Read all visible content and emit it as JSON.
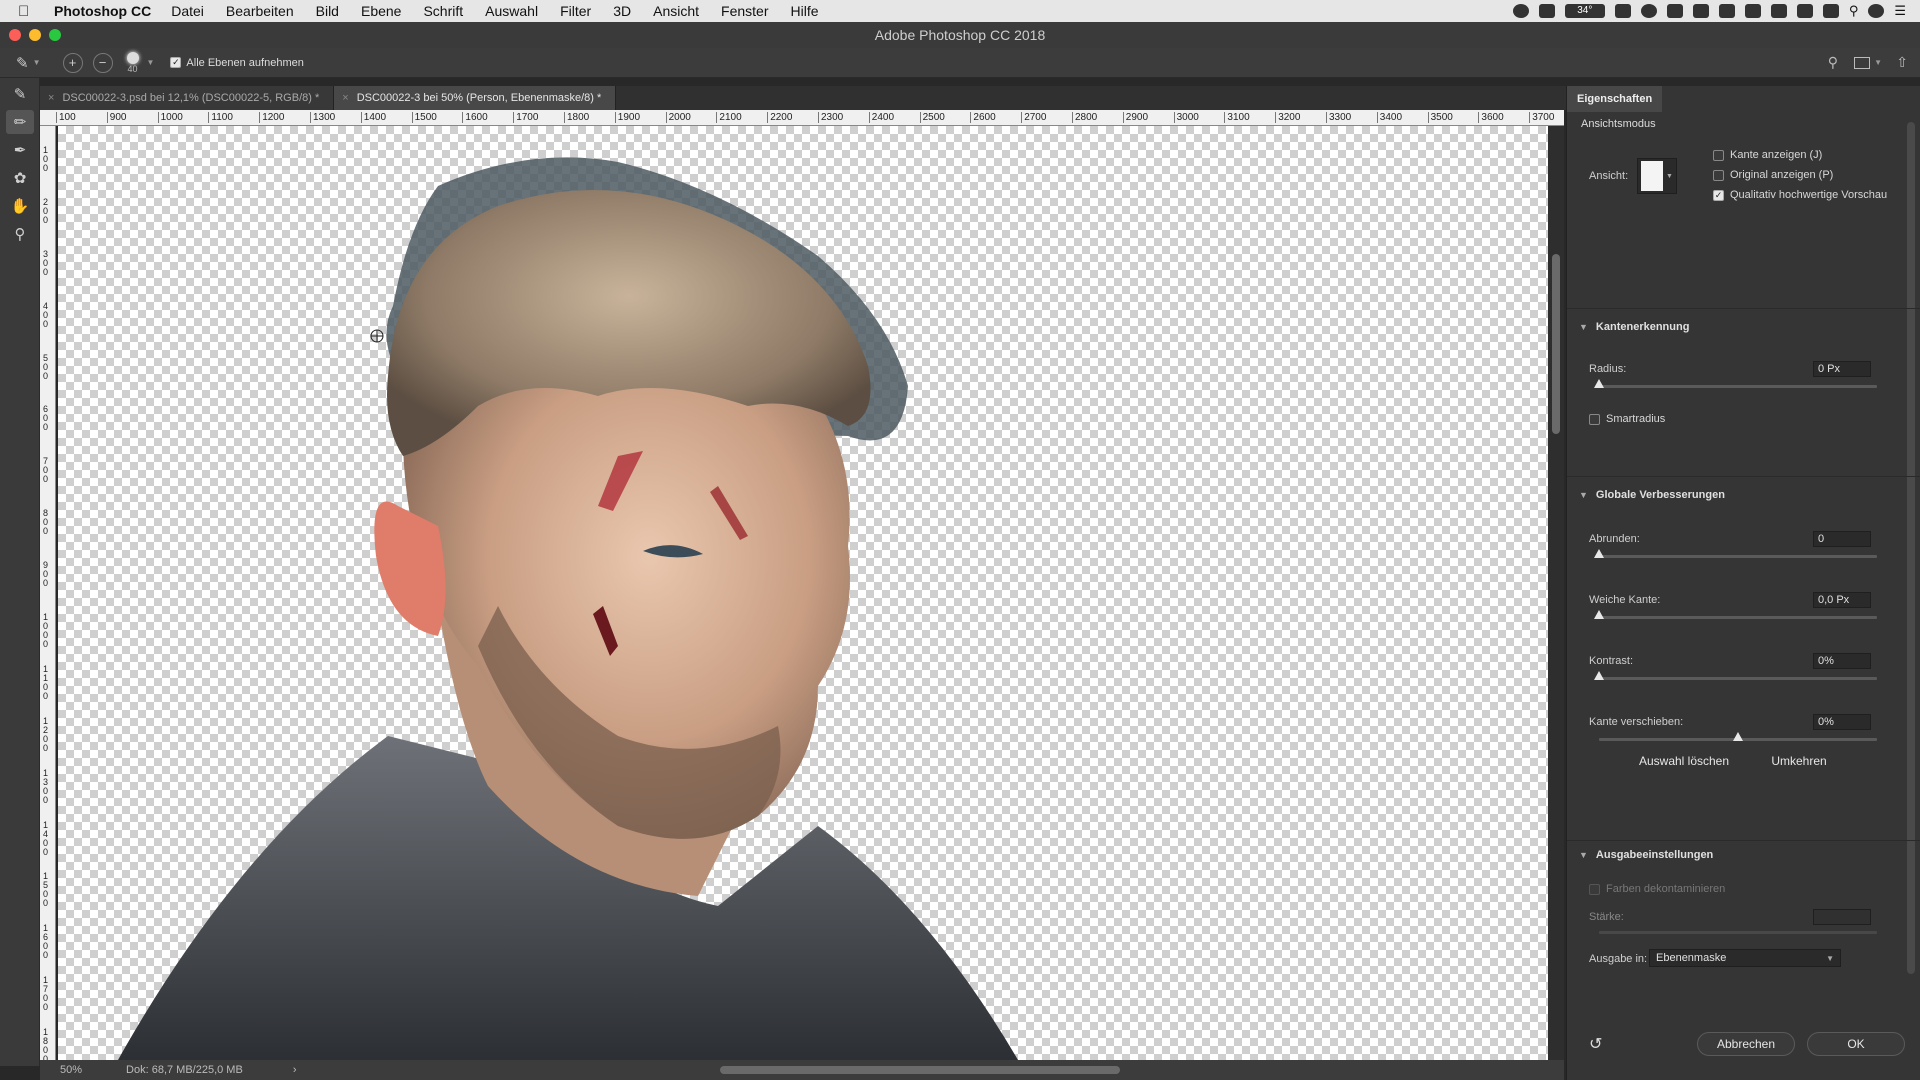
{
  "menubar": {
    "app_name": "Photoshop CC",
    "items": [
      "Datei",
      "Bearbeiten",
      "Bild",
      "Ebene",
      "Schrift",
      "Auswahl",
      "Filter",
      "3D",
      "Ansicht",
      "Fenster",
      "Hilfe"
    ],
    "temperature": "34°"
  },
  "window": {
    "title": "Adobe Photoshop CC 2018"
  },
  "options": {
    "brush_size": "40",
    "sample_all_layers_label": "Alle Ebenen aufnehmen",
    "sample_all_layers_checked": true
  },
  "tabs": [
    {
      "label": "DSC00022-3.psd bei 12,1% (DSC00022-5, RGB/8) *",
      "active": false
    },
    {
      "label": "DSC00022-3 bei 50% (Person, Ebenenmaske/8) *",
      "active": true
    }
  ],
  "ruler": {
    "top_ticks": [
      "100",
      "900",
      "1000",
      "1100",
      "1200",
      "1300",
      "1400",
      "1500",
      "1600",
      "1700",
      "1800",
      "1900",
      "2000",
      "2100",
      "2200",
      "2300",
      "2400",
      "2500",
      "2600",
      "2700",
      "2800",
      "2900",
      "3000",
      "3100",
      "3200",
      "3300",
      "3400",
      "3500",
      "3600",
      "3700"
    ],
    "left_ticks": [
      "1 0 0",
      "2 0 0",
      "3 0 0",
      "4 0 0",
      "5 0 0",
      "6 0 0",
      "7 0 0",
      "8 0 0",
      "9 0 0",
      "1 0 0 0",
      "1 1 0 0",
      "1 2 0 0",
      "1 3 0 0",
      "1 4 0 0",
      "1 5 0 0",
      "1 6 0 0",
      "1 7 0 0",
      "1 8 0 0"
    ]
  },
  "status": {
    "zoom": "50%",
    "doc": "Dok: 68,7 MB/225,0 MB",
    "arrow": "›"
  },
  "panel": {
    "tab_label": "Eigenschaften",
    "view_mode": {
      "title": "Ansichtsmodus",
      "view_label": "Ansicht:",
      "show_edge": {
        "label": "Kante anzeigen (J)",
        "checked": false
      },
      "show_original": {
        "label": "Original anzeigen (P)",
        "checked": false
      },
      "hq_preview": {
        "label": "Qualitativ hochwertige Vorschau",
        "checked": true
      }
    },
    "edge_detection": {
      "title": "Kantenerkennung",
      "radius_label": "Radius:",
      "radius_value": "0 Px",
      "radius_level": 0,
      "smart_radius_label": "Smartradius",
      "smart_radius_checked": false
    },
    "global_refinements": {
      "title": "Globale Verbesserungen",
      "smooth_label": "Abrunden:",
      "smooth_value": "0",
      "smooth_level": 0,
      "feather_label": "Weiche Kante:",
      "feather_value": "0,0 Px",
      "feather_level": 0,
      "contrast_label": "Kontrast:",
      "contrast_value": "0%",
      "contrast_level": 0,
      "shift_edge_label": "Kante verschieben:",
      "shift_edge_value": "0%",
      "shift_edge_level": 0.5,
      "clear_button": "Auswahl löschen",
      "invert_button": "Umkehren"
    },
    "output": {
      "title": "Ausgabeeinstellungen",
      "decontaminate_label": "Farben dekontaminieren",
      "amount_label": "Stärke:",
      "output_to_label": "Ausgabe in:",
      "output_to_value": "Ebenenmaske"
    },
    "cancel_button": "Abbrechen",
    "ok_button": "OK"
  },
  "colors": {
    "accent": "#3a3a3a",
    "traffic_red": "#fc5f57",
    "traffic_yellow": "#fdbc2e",
    "traffic_green": "#29c840"
  }
}
